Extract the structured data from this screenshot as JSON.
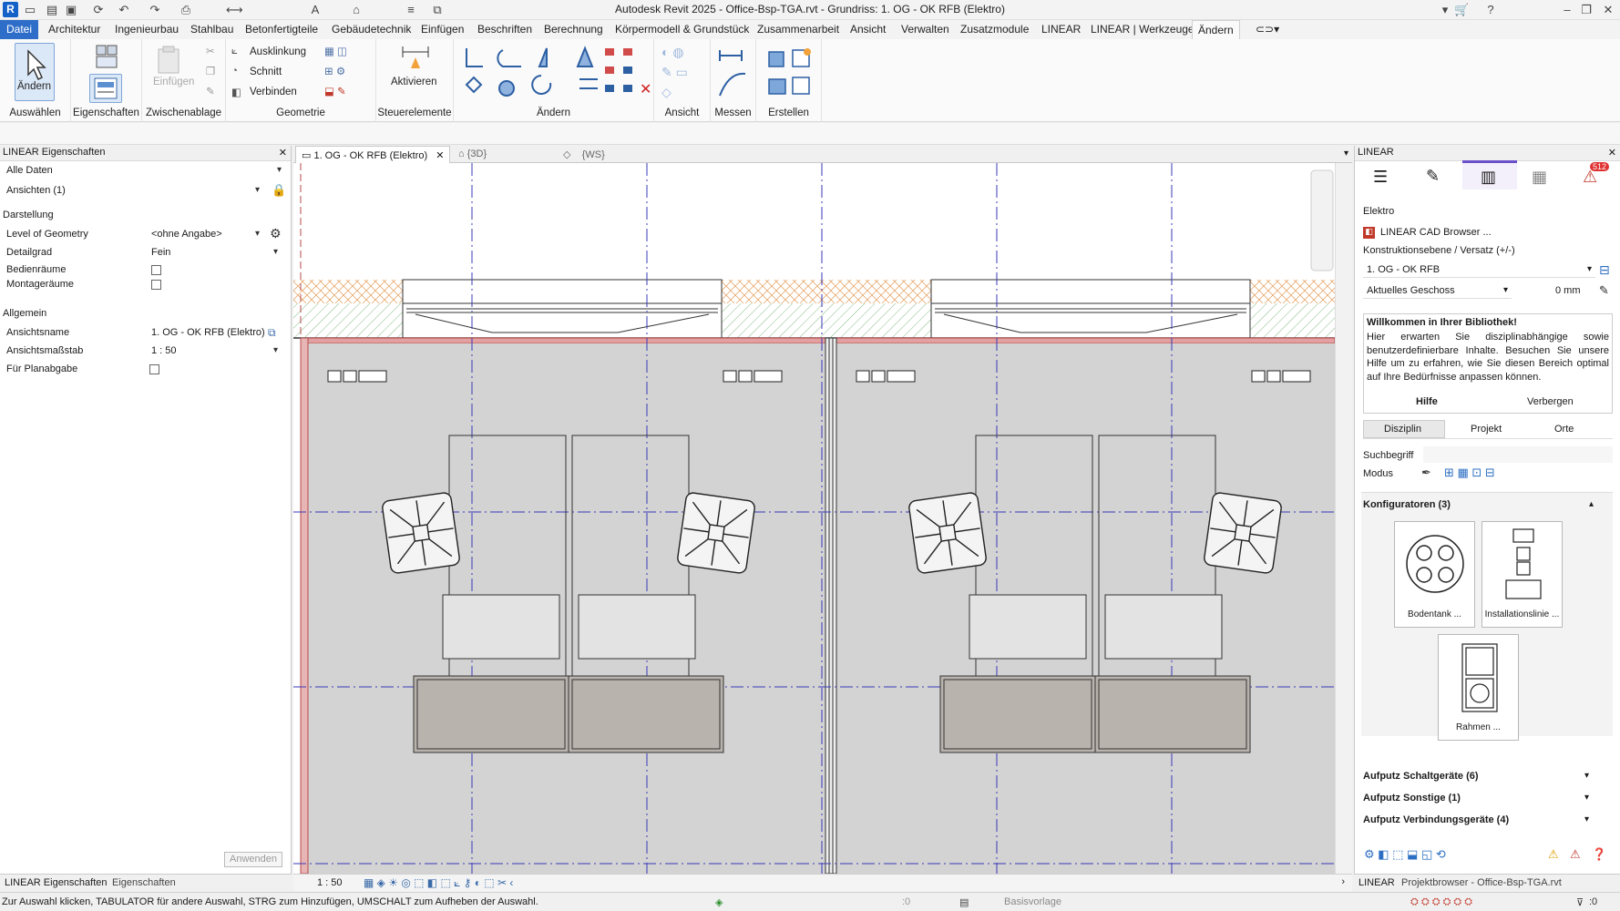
{
  "window": {
    "title": "Autodesk Revit 2025 - Office-Bsp-TGA.rvt - Grundriss: 1. OG - OK RFB (Elektro)"
  },
  "menu": [
    "Datei",
    "Architektur",
    "Ingenieurbau",
    "Stahlbau",
    "Betonfertigteile",
    "Gebäudetechnik",
    "Einfügen",
    "Beschriften",
    "Berechnung",
    "Körpermodell & Grundstück",
    "Zusammenarbeit",
    "Ansicht",
    "Verwalten",
    "Zusatzmodule",
    "LINEAR",
    "LINEAR | Werkzeuge",
    "Ändern"
  ],
  "ribbon": {
    "aendern_btn": "Ändern",
    "auswaehlen": "Auswählen",
    "eigenschaften": "Eigenschaften",
    "einfuegen": "Einfügen",
    "zwischenablage": "Zwischenablage",
    "ausklinkung": "Ausklinkung",
    "schnitt": "Schnitt",
    "verbinden": "Verbinden",
    "geometrie": "Geometrie",
    "aktivieren": "Aktivieren",
    "steuerelemente": "Steuerelemente",
    "aendern_grp": "Ändern",
    "ansicht": "Ansicht",
    "messen": "Messen",
    "erstellen": "Erstellen"
  },
  "left_panel": {
    "title": "LINEAR Eigenschaften",
    "filter": "Alle Daten",
    "views": "Ansichten (1)",
    "section_darstellung": "Darstellung",
    "rows": [
      {
        "k": "Level of Geometry",
        "v": "<ohne Angabe>"
      },
      {
        "k": "Detailgrad",
        "v": "Fein"
      },
      {
        "k": "Bedienräume",
        "v": ""
      },
      {
        "k": "Montageräume",
        "v": ""
      }
    ],
    "section_allgemein": "Allgemein",
    "rows2": [
      {
        "k": "Ansichtsname",
        "v": "1. OG - OK RFB (Elektro)"
      },
      {
        "k": "Ansichtsmaßstab",
        "v": "1 : 50"
      },
      {
        "k": "Für Planabgabe",
        "v": ""
      }
    ],
    "apply": "Anwenden",
    "tabs": [
      "LINEAR Eigenschaften",
      "Eigenschaften"
    ]
  },
  "view_tabs": [
    "1. OG - OK RFB (Elektro)",
    "{3D}",
    "{WS}"
  ],
  "view_status": {
    "scale": "1 : 50"
  },
  "right_panel": {
    "title": "LINEAR",
    "badge": "512",
    "discipline": "Elektro",
    "cad_browser": "LINEAR CAD Browser ...",
    "level_label": "Konstruktionsebene / Versatz (+/-)",
    "level": "1. OG - OK RFB",
    "floor": "Aktuelles Geschoss",
    "offset": "0 mm",
    "welcome_title": "Willkommen in Ihrer Bibliothek!",
    "welcome_text": "Hier erwarten Sie disziplinabhängige sowie benutzerdefinierbare Inhalte. Besuchen Sie unsere Hilfe um zu erfahren, wie Sie diesen Bereich optimal auf Ihre Bedürfnisse anpassen können.",
    "help": "Hilfe",
    "hide": "Verbergen",
    "tabs": [
      "Disziplin",
      "Projekt",
      "Orte"
    ],
    "search_label": "Suchbegriff",
    "mode_label": "Modus",
    "configurators": "Konfiguratoren (3)",
    "cards": [
      "Bodentank ...",
      "Installationslinie ...",
      "Rahmen ..."
    ],
    "categories": [
      "Aufputz Schaltgeräte (6)",
      "Aufputz Sonstige (1)",
      "Aufputz Verbindungsgeräte (4)"
    ],
    "bottom_tabs": [
      "LINEAR",
      "Projektbrowser - Office-Bsp-TGA.rvt"
    ]
  },
  "status": {
    "hint": "Zur Auswahl klicken, TABULATOR für andere Auswahl, STRG zum Hinzufügen, UMSCHALT zum Aufheben der Auswahl.",
    "zero1": ":0",
    "template": "Basisvorlage",
    "zero2": ":0"
  }
}
